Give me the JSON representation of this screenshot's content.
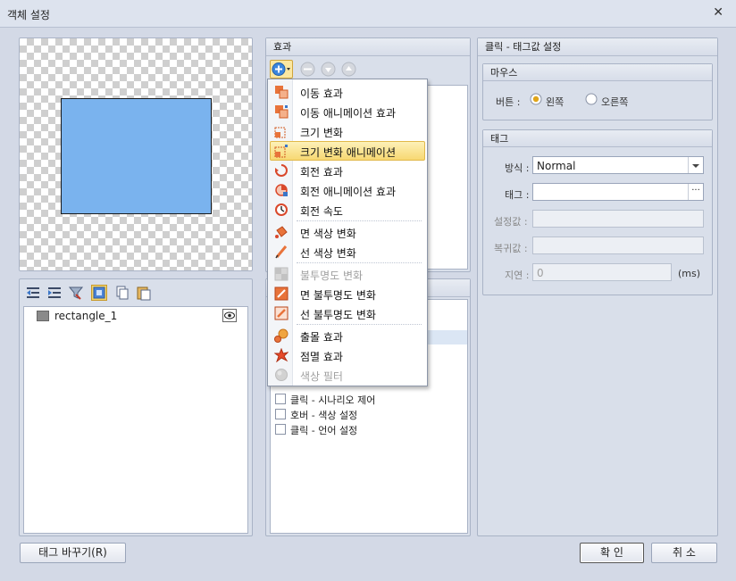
{
  "window": {
    "title": "객체 설정",
    "close_glyph": "✕"
  },
  "preview": {
    "shape_color": "#7ab3ee"
  },
  "layers": {
    "toolbar_icons": [
      "indent-left-icon",
      "indent-right-icon",
      "filter-icon",
      "select-all-icon",
      "copy-icon",
      "paste-icon"
    ],
    "items": [
      {
        "name": "rectangle_1",
        "visibility_icon": "eye-icon"
      }
    ]
  },
  "effects": {
    "header": "효과",
    "toolbar_icons": [
      "add-icon",
      "remove-icon",
      "move-down-icon",
      "move-up-icon"
    ],
    "menu": [
      {
        "label": "이동 효과",
        "icon": "move-effect-icon",
        "enabled": true
      },
      {
        "label": "이동 애니메이션 효과",
        "icon": "move-animation-icon",
        "enabled": true
      },
      {
        "label": "크기 변화",
        "icon": "size-change-icon",
        "enabled": true
      },
      {
        "label": "크기 변화 애니메이션",
        "icon": "size-animation-icon",
        "enabled": true,
        "selected": true
      },
      {
        "label": "회전 효과",
        "icon": "rotate-effect-icon",
        "enabled": true
      },
      {
        "label": "회전 애니메이션 효과",
        "icon": "rotate-animation-icon",
        "enabled": true
      },
      {
        "label": "회전 속도",
        "icon": "rotate-speed-icon",
        "enabled": true
      },
      {
        "label": "면 색상 변화",
        "icon": "fill-color-icon",
        "enabled": true
      },
      {
        "label": "선 색상 변화",
        "icon": "line-color-icon",
        "enabled": true
      },
      {
        "label": "불투명도 변화",
        "icon": "opacity-icon",
        "enabled": false
      },
      {
        "label": "면 불투명도 변화",
        "icon": "fill-opacity-icon",
        "enabled": true
      },
      {
        "label": "선 불투명도 변화",
        "icon": "line-opacity-icon",
        "enabled": true
      },
      {
        "label": "출몰 효과",
        "icon": "appear-icon",
        "enabled": true
      },
      {
        "label": "점멸 효과",
        "icon": "blink-icon",
        "enabled": true
      },
      {
        "label": "색상 필터",
        "icon": "color-filter-icon",
        "enabled": false
      }
    ]
  },
  "triggers": {
    "items": [
      {
        "label": "클릭 - 시나리오 제어",
        "checked": false
      },
      {
        "label": "호버 - 색상 설정",
        "checked": false
      },
      {
        "label": "클릭 - 언어 설정",
        "checked": false
      }
    ]
  },
  "settings": {
    "header": "클릭 - 태그값 설정",
    "mouse": {
      "title": "마우스",
      "button_label": "버튼 :",
      "options": [
        {
          "label": "왼쪽",
          "selected": true
        },
        {
          "label": "오른쪽",
          "selected": false
        }
      ]
    },
    "tag": {
      "title": "태그",
      "method_label": "방식 :",
      "method_value": "Normal",
      "tag_label": "태그 :",
      "tag_value": "",
      "browse_label": "···",
      "set_label": "설정값 :",
      "restore_label": "복귀값 :",
      "delay_label": "지연 :",
      "delay_placeholder": "0",
      "delay_unit": "(ms)"
    }
  },
  "footer": {
    "swap_tag_button": "태그 바꾸기(R)",
    "ok_button": "확 인",
    "cancel_button": "취 소"
  }
}
